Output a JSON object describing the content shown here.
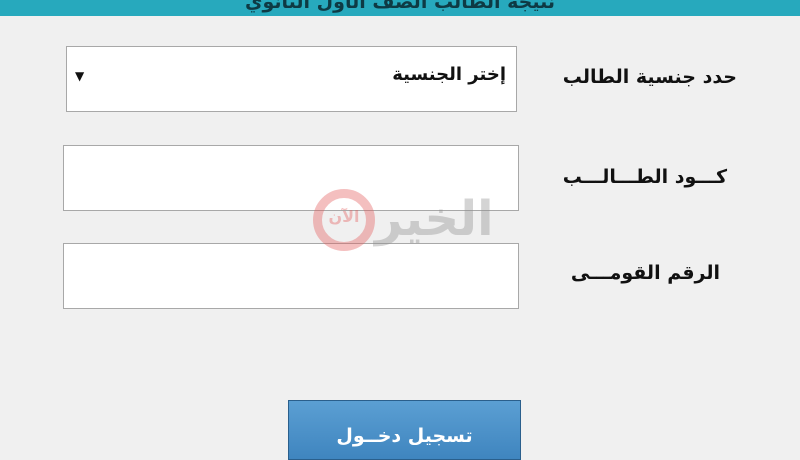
{
  "header": {
    "title": "نتيجة الطالب الصف الأول الثانوي"
  },
  "form": {
    "nationality": {
      "label": "حدد جنسية الطالب",
      "selected": "إختر الجنسية"
    },
    "student_code": {
      "label": "كـــود الطـــالـــب",
      "value": ""
    },
    "national_id": {
      "label": "الرقم القومـــى",
      "value": ""
    },
    "login_button": "تسجيل دخــول"
  },
  "watermark": {
    "brand": "الخير",
    "sub": "الآن"
  },
  "colors": {
    "header": "#27a9bd",
    "button": "#4a8fc8",
    "watermark_red": "#e45a5a"
  },
  "icons": {
    "dropdown": "triangle-down"
  }
}
